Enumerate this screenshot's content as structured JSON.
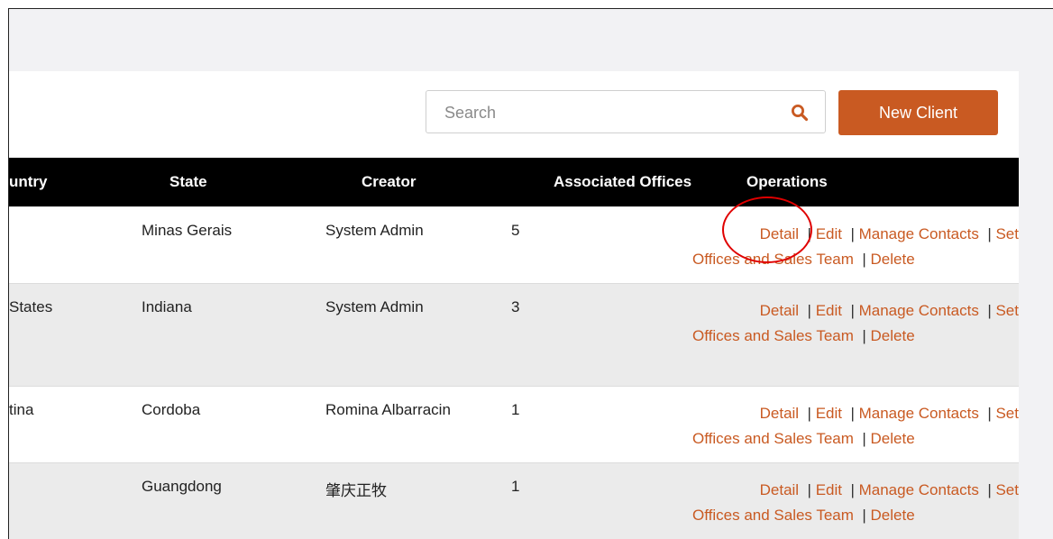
{
  "search": {
    "placeholder": "Search",
    "icon": "search-icon"
  },
  "toolbar": {
    "new_client_label": "New Client"
  },
  "colors": {
    "accent": "#c95a22",
    "header_bg": "#000000",
    "row_alt": "#ebebeb",
    "annotation": "#e00000"
  },
  "table": {
    "columns": {
      "country": "untry",
      "state": "State",
      "creator": "Creator",
      "offices": "Associated Offices",
      "operations": "Operations"
    },
    "operations": {
      "detail": "Detail",
      "edit": "Edit",
      "manage_contacts": "Manage Contacts",
      "set": "Set",
      "offices_sales": "Offices and Sales Team",
      "delete": "Delete",
      "separator": "|"
    },
    "rows": [
      {
        "country": "",
        "state": "Minas Gerais",
        "creator": "System Admin",
        "offices": "5"
      },
      {
        "country": "States",
        "state": "Indiana",
        "creator": "System Admin",
        "offices": "3"
      },
      {
        "country": "tina",
        "state": "Cordoba",
        "creator": "Romina Albarracin",
        "offices": "1"
      },
      {
        "country": "",
        "state": "Guangdong",
        "creator": "肇庆正牧",
        "offices": "1"
      }
    ]
  }
}
